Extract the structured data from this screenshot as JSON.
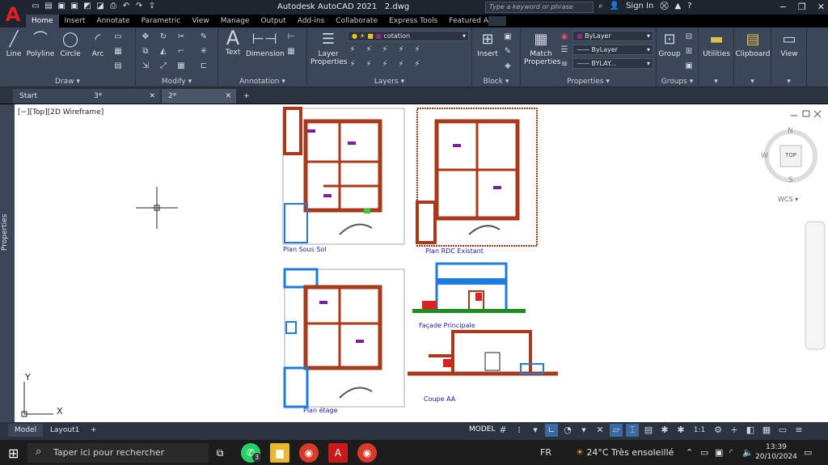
{
  "app": {
    "logo": "A",
    "title": "Autodesk AutoCAD 2021",
    "document": "2.dwg",
    "search_placeholder": "Type a keyword or phrase",
    "sign_in": "Sign In"
  },
  "ribbon_tabs": [
    "Home",
    "Insert",
    "Annotate",
    "Parametric",
    "View",
    "Manage",
    "Output",
    "Add-ins",
    "Collaborate",
    "Express Tools",
    "Featured Apps"
  ],
  "active_tab": "Home",
  "draw_panel": {
    "label": "Draw",
    "tools": [
      "Line",
      "Polyline",
      "Circle",
      "Arc"
    ]
  },
  "modify_panel": {
    "label": "Modify"
  },
  "annotation_panel": {
    "label": "Annotation",
    "tools": [
      "Text",
      "Dimension"
    ]
  },
  "layers_panel": {
    "label": "Layers",
    "layer_properties": "Layer Properties",
    "current_layer": "cotation"
  },
  "block_panel": {
    "label": "Block",
    "insert": "Insert"
  },
  "properties_panel": {
    "label": "Properties",
    "match": "Match Properties",
    "color": "ByLayer",
    "linetype": "ByLayer",
    "lineweight": "BYLAY..."
  },
  "groups_panel": {
    "label": "Groups",
    "group": "Group"
  },
  "utilities": "Utilities",
  "clipboard": "Clipboard",
  "view": "View",
  "file_tabs": [
    {
      "label": "Start"
    },
    {
      "label": "3*"
    },
    {
      "label": "2*"
    }
  ],
  "viewport_label": "[−][Top][2D Wireframe]",
  "sidebar_label": "Properties",
  "viewcube": {
    "top": "TOP",
    "n": "N",
    "s": "S",
    "w": "W",
    "wcs": "WCS"
  },
  "drawings": {
    "plan_sous_sol": "Plan Sous Sol",
    "plan_rdc": "Plan RDC Existant",
    "plan_etage": "Plan étage",
    "facade": "Façade Principale",
    "coupe": "Coupe AA"
  },
  "layout_tabs": [
    "Model",
    "Layout1"
  ],
  "status": {
    "model": "MODEL",
    "scale": "1:1"
  },
  "taskbar": {
    "search": "Taper ici pour rechercher",
    "lang": "FR",
    "weather": "24°C  Très ensoleillé",
    "time": "13:39",
    "date": "20/10/2024",
    "whatsapp_badge": "3"
  },
  "colors": {
    "ribbon": "#3b4658",
    "titlebar": "#1e2430",
    "wall": "#a83a1a",
    "accent_blue": "#1e7be0"
  }
}
